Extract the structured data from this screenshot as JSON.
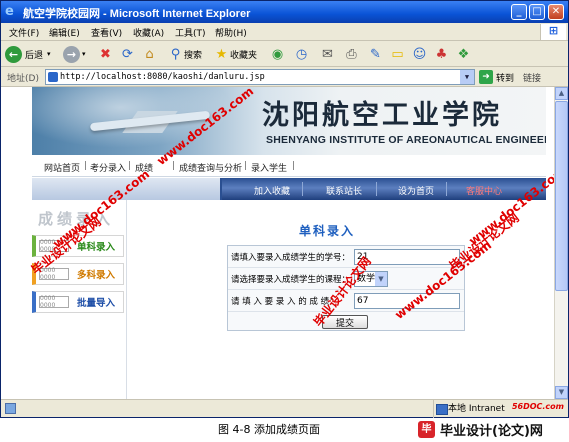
{
  "window": {
    "title": "航空学院校园网 - Microsoft Internet Explorer",
    "min": "_",
    "max": "□",
    "close": "✕"
  },
  "menu": [
    "文件(F)",
    "编辑(E)",
    "查看(V)",
    "收藏(A)",
    "工具(T)",
    "帮助(H)"
  ],
  "toolbar": {
    "back": "后退",
    "search": "搜索",
    "favorites": "收藏夹"
  },
  "address": {
    "label": "地址(D)",
    "url": "http://localhost:8080/kaoshi/danluru.jsp",
    "go": "转到",
    "links": "链接"
  },
  "banner": {
    "title_zh": "沈阳航空工业学院",
    "title_en": "SHENYANG INSTITUTE OF AREONAUTICAL ENGINEERING"
  },
  "topnav": [
    "网站首页",
    "考分录入",
    "成绩",
    "成绩查询与分析",
    "录入学生"
  ],
  "bluebar": [
    "加入收藏",
    "联系站长",
    "设为首页",
    "客服中心"
  ],
  "sidebar": {
    "header": "成绩录入",
    "items": [
      {
        "label": "单科录入",
        "color": "#6bb23e"
      },
      {
        "label": "多科录入",
        "color": "#f0a020"
      },
      {
        "label": "批量导入",
        "color": "#3a6fc6"
      }
    ],
    "tag_text": "0000 0000"
  },
  "form": {
    "title": "单科录入",
    "student_id_label": "请填入要录入成绩学生的学号：",
    "student_id_value": "21",
    "course_label": "请选择要录入成绩学生的课程：",
    "course_value": "数学",
    "score_label": "请 填 入 要 录 入 的 成 绩：",
    "score_value": "67",
    "submit": "提交"
  },
  "watermarks": {
    "site_cn": "毕业设计论文网",
    "site_url": "www.doc163.com"
  },
  "status": {
    "zone": "本地 Intranet",
    "brand": "56DOC.com"
  },
  "caption": "图 4-8 添加成绩页面",
  "footer_logo": "毕业设计(论文)网",
  "footer_mark": "毕"
}
